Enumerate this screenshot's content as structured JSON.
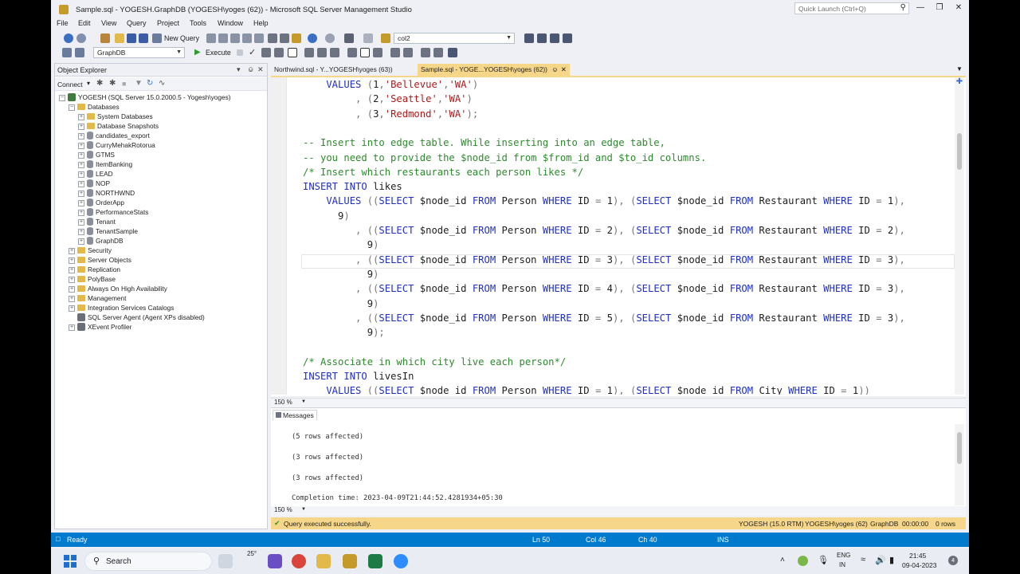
{
  "window": {
    "title": "Sample.sql - YOGESH.GraphDB (YOGESH\\yoges (62)) - Microsoft SQL Server Management Studio",
    "quick_launch": "Quick Launch (Ctrl+Q)"
  },
  "menu": [
    "File",
    "Edit",
    "View",
    "Query",
    "Project",
    "Tools",
    "Window",
    "Help"
  ],
  "toolbar": {
    "new_query": "New Query",
    "search_combo": "col2",
    "db_combo": "GraphDB",
    "execute": "Execute"
  },
  "object_explorer": {
    "title": "Object Explorer",
    "connect": "Connect",
    "server": "YOGESH (SQL Server 15.0.2000.5 - Yogesh\\yoges)",
    "databases_label": "Databases",
    "databases": [
      "System Databases",
      "Database Snapshots",
      "candidates_export",
      "CurryMehakRotorua",
      "GTMS",
      "ItemBanking",
      "LEAD",
      "NOP",
      "NORTHWND",
      "OrderApp",
      "PerformanceStats",
      "Tenant",
      "TenantSample",
      "GraphDB"
    ],
    "other_nodes": [
      "Security",
      "Server Objects",
      "Replication",
      "PolyBase",
      "Always On High Availability",
      "Management",
      "Integration Services Catalogs"
    ],
    "agent": "SQL Server Agent (Agent XPs disabled)",
    "xevent": "XEvent Profiler"
  },
  "tabs": [
    {
      "label": "Northwind.sql - Y...YOGESH\\yoges (63))"
    },
    {
      "label": "Sample.sql - YOGE...YOGESH\\yoges (62))"
    }
  ],
  "editor": {
    "zoom": "150 %",
    "lines": [
      [
        [
          "kw",
          "    VALUES "
        ],
        [
          "op",
          "("
        ],
        [
          "id",
          "1"
        ],
        [
          "op",
          ","
        ],
        [
          "st",
          "'Bellevue'"
        ],
        [
          "op",
          ","
        ],
        [
          "st",
          "'WA'"
        ],
        [
          "op",
          ")"
        ]
      ],
      [
        [
          "op",
          "         , ("
        ],
        [
          "id",
          "2"
        ],
        [
          "op",
          ","
        ],
        [
          "st",
          "'Seattle'"
        ],
        [
          "op",
          ","
        ],
        [
          "st",
          "'WA'"
        ],
        [
          "op",
          ")"
        ]
      ],
      [
        [
          "op",
          "         , ("
        ],
        [
          "id",
          "3"
        ],
        [
          "op",
          ","
        ],
        [
          "st",
          "'Redmond'"
        ],
        [
          "op",
          ","
        ],
        [
          "st",
          "'WA'"
        ],
        [
          "op",
          ");"
        ]
      ],
      [],
      [
        [
          "cm",
          "-- Insert into edge table. While inserting into an edge table,"
        ]
      ],
      [
        [
          "cm",
          "-- you need to provide the $node_id from $from_id and $to_id columns."
        ]
      ],
      [
        [
          "cm",
          "/* Insert which restaurants each person likes */"
        ]
      ],
      [
        [
          "kw",
          "INSERT INTO "
        ],
        [
          "id",
          "likes"
        ]
      ],
      [
        [
          "kw",
          "    VALUES "
        ],
        [
          "op",
          "(("
        ],
        [
          "kw",
          "SELECT "
        ],
        [
          "id",
          "$node_id "
        ],
        [
          "kw",
          "FROM "
        ],
        [
          "id",
          "Person "
        ],
        [
          "kw",
          "WHERE "
        ],
        [
          "id",
          "ID "
        ],
        [
          "op",
          "= "
        ],
        [
          "id",
          "1"
        ],
        [
          "op",
          "), ("
        ],
        [
          "kw",
          "SELECT "
        ],
        [
          "id",
          "$node_id "
        ],
        [
          "kw",
          "FROM "
        ],
        [
          "id",
          "Restaurant "
        ],
        [
          "kw",
          "WHERE "
        ],
        [
          "id",
          "ID "
        ],
        [
          "op",
          "= "
        ],
        [
          "id",
          "1"
        ],
        [
          "op",
          "),"
        ]
      ],
      [
        [
          "id",
          "      9"
        ],
        [
          "op",
          ")"
        ]
      ],
      [
        [
          "op",
          "         , (("
        ],
        [
          "kw",
          "SELECT "
        ],
        [
          "id",
          "$node_id "
        ],
        [
          "kw",
          "FROM "
        ],
        [
          "id",
          "Person "
        ],
        [
          "kw",
          "WHERE "
        ],
        [
          "id",
          "ID "
        ],
        [
          "op",
          "= "
        ],
        [
          "id",
          "2"
        ],
        [
          "op",
          "), ("
        ],
        [
          "kw",
          "SELECT "
        ],
        [
          "id",
          "$node_id "
        ],
        [
          "kw",
          "FROM "
        ],
        [
          "id",
          "Restaurant "
        ],
        [
          "kw",
          "WHERE "
        ],
        [
          "id",
          "ID "
        ],
        [
          "op",
          "= "
        ],
        [
          "id",
          "2"
        ],
        [
          "op",
          "),"
        ]
      ],
      [
        [
          "id",
          "           9"
        ],
        [
          "op",
          ")"
        ]
      ],
      [
        [
          "op",
          "         , (("
        ],
        [
          "kw",
          "SELECT "
        ],
        [
          "id",
          "$node_id "
        ],
        [
          "kw",
          "FROM "
        ],
        [
          "id",
          "Person "
        ],
        [
          "kw",
          "WHERE "
        ],
        [
          "id",
          "ID "
        ],
        [
          "op",
          "= "
        ],
        [
          "id",
          "3"
        ],
        [
          "op",
          "), ("
        ],
        [
          "kw",
          "SELECT "
        ],
        [
          "id",
          "$node_id "
        ],
        [
          "kw",
          "FROM "
        ],
        [
          "id",
          "Restaurant "
        ],
        [
          "kw",
          "WHERE "
        ],
        [
          "id",
          "ID "
        ],
        [
          "op",
          "= "
        ],
        [
          "id",
          "3"
        ],
        [
          "op",
          "),"
        ]
      ],
      [
        [
          "id",
          "           9"
        ],
        [
          "op",
          ")"
        ]
      ],
      [
        [
          "op",
          "         , (("
        ],
        [
          "kw",
          "SELECT "
        ],
        [
          "id",
          "$node_id "
        ],
        [
          "kw",
          "FROM "
        ],
        [
          "id",
          "Person "
        ],
        [
          "kw",
          "WHERE "
        ],
        [
          "id",
          "ID "
        ],
        [
          "op",
          "= "
        ],
        [
          "id",
          "4"
        ],
        [
          "op",
          "), ("
        ],
        [
          "kw",
          "SELECT "
        ],
        [
          "id",
          "$node_id "
        ],
        [
          "kw",
          "FROM "
        ],
        [
          "id",
          "Restaurant "
        ],
        [
          "kw",
          "WHERE "
        ],
        [
          "id",
          "ID "
        ],
        [
          "op",
          "= "
        ],
        [
          "id",
          "3"
        ],
        [
          "op",
          "),"
        ]
      ],
      [
        [
          "id",
          "           9"
        ],
        [
          "op",
          ")"
        ]
      ],
      [
        [
          "op",
          "         , (("
        ],
        [
          "kw",
          "SELECT "
        ],
        [
          "id",
          "$node_id "
        ],
        [
          "kw",
          "FROM "
        ],
        [
          "id",
          "Person "
        ],
        [
          "kw",
          "WHERE "
        ],
        [
          "id",
          "ID "
        ],
        [
          "op",
          "= "
        ],
        [
          "id",
          "5"
        ],
        [
          "op",
          "), ("
        ],
        [
          "kw",
          "SELECT "
        ],
        [
          "id",
          "$node_id "
        ],
        [
          "kw",
          "FROM "
        ],
        [
          "id",
          "Restaurant "
        ],
        [
          "kw",
          "WHERE "
        ],
        [
          "id",
          "ID "
        ],
        [
          "op",
          "= "
        ],
        [
          "id",
          "3"
        ],
        [
          "op",
          "),"
        ]
      ],
      [
        [
          "id",
          "           9"
        ],
        [
          "op",
          ");"
        ]
      ],
      [],
      [
        [
          "cm",
          "/* Associate in which city live each person*/"
        ]
      ],
      [
        [
          "kw",
          "INSERT INTO "
        ],
        [
          "id",
          "livesIn"
        ]
      ],
      [
        [
          "kw",
          "    VALUES "
        ],
        [
          "op",
          "(("
        ],
        [
          "kw",
          "SELECT "
        ],
        [
          "id",
          "$node_id "
        ],
        [
          "kw",
          "FROM "
        ],
        [
          "id",
          "Person "
        ],
        [
          "kw",
          "WHERE "
        ],
        [
          "id",
          "ID "
        ],
        [
          "op",
          "= "
        ],
        [
          "id",
          "1"
        ],
        [
          "op",
          "), ("
        ],
        [
          "kw",
          "SELECT "
        ],
        [
          "id",
          "$node_id "
        ],
        [
          "kw",
          "FROM "
        ],
        [
          "id",
          "City "
        ],
        [
          "kw",
          "WHERE "
        ],
        [
          "id",
          "ID "
        ],
        [
          "op",
          "= "
        ],
        [
          "id",
          "1"
        ],
        [
          "op",
          "))"
        ]
      ]
    ]
  },
  "results": {
    "tab_label": "Messages",
    "messages": [
      "(5 rows affected)",
      "(3 rows affected)",
      "(3 rows affected)",
      "Completion time: 2023-04-09T21:44:52.4281934+05:30"
    ],
    "zoom": "150 %"
  },
  "query_status": {
    "message": "Query executed successfully.",
    "server": "YOGESH (15.0 RTM)",
    "user": "YOGESH\\yoges (62)",
    "db": "GraphDB",
    "time": "00:00:00",
    "rows": "0 rows"
  },
  "status": {
    "ready": "Ready",
    "ln": "Ln 50",
    "col": "Col 46",
    "ch": "Ch 40",
    "ins": "INS"
  },
  "taskbar": {
    "search": "Search",
    "weather": "25°",
    "lang1": "ENG",
    "lang2": "IN",
    "time": "21:45",
    "date": "09-04-2023",
    "badge": "4"
  },
  "colors": {
    "status_bar": "#007acc",
    "active_tab": "#f6d78a",
    "keyword": "#1f2fc8",
    "string": "#b01818",
    "comment": "#2d8a2d"
  }
}
